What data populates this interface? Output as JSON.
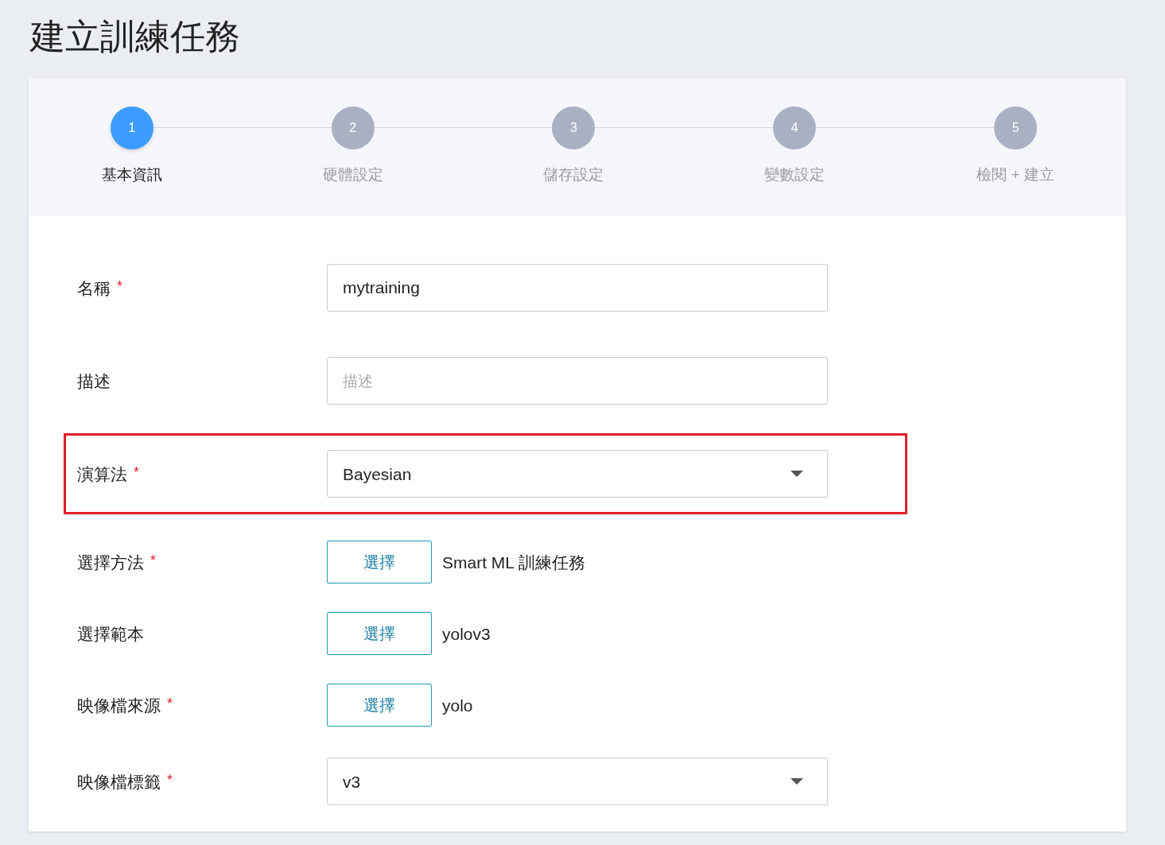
{
  "page_title": "建立訓練任務",
  "steps": [
    {
      "number": "1",
      "label": "基本資訊",
      "selected": true
    },
    {
      "number": "2",
      "label": "硬體設定",
      "selected": false
    },
    {
      "number": "3",
      "label": "儲存設定",
      "selected": false
    },
    {
      "number": "4",
      "label": "變數設定",
      "selected": false
    },
    {
      "number": "5",
      "label": "檢閱 + 建立",
      "selected": false
    }
  ],
  "fields": [
    {
      "kind": "text",
      "label": "名稱",
      "required_mark": "*",
      "value": "mytraining",
      "highlighted": false
    },
    {
      "kind": "text",
      "label": "描述",
      "placeholder": "描述",
      "highlighted": false
    },
    {
      "kind": "select",
      "label": "演算法",
      "required_mark": "*",
      "value": "Bayesian",
      "highlighted": true
    },
    {
      "kind": "choose",
      "label": "選擇方法",
      "required_mark": "*",
      "button": "選擇",
      "value": "Smart ML 訓練任務",
      "highlighted": false
    },
    {
      "kind": "choose",
      "label": "選擇範本",
      "button": "選擇",
      "value": "yolov3",
      "highlighted": false
    },
    {
      "kind": "choose",
      "label": "映像檔來源",
      "required_mark": "*",
      "button": "選擇",
      "value": "yolo",
      "highlighted": false
    },
    {
      "kind": "select",
      "label": "映像檔標籤",
      "required_mark": "*",
      "value": "v3",
      "highlighted": false
    }
  ]
}
